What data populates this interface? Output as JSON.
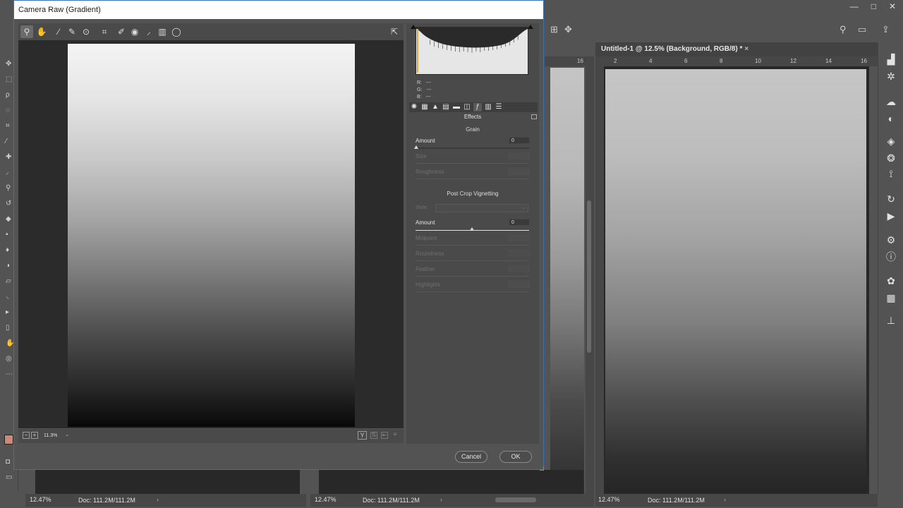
{
  "dialog": {
    "title": "Camera Raw (Gradient)",
    "ok_label": "OK",
    "cancel_label": "Cancel"
  },
  "toolbar_tools": [
    "zoom-tool",
    "hand-tool",
    "white-balance-tool",
    "color-sampler-tool",
    "targeted-adjustment-tool",
    "crop-tool",
    "straighten-tool",
    "red-eye-tool",
    "adjustment-brush-tool",
    "graduated-filter-tool",
    "radial-filter-tool"
  ],
  "preview": {
    "zoom_level": "11.3%",
    "zoom_chevron": "⌄",
    "before_after": "Y"
  },
  "readout": {
    "r_label": "R:",
    "r_value": "---",
    "g_label": "G:",
    "g_value": "---",
    "b_label": "B:",
    "b_value": "---"
  },
  "panel": {
    "name": "Effects",
    "grain": {
      "title": "Grain",
      "amount_label": "Amount",
      "amount_value": "0",
      "size_label": "Size",
      "roughness_label": "Roughness"
    },
    "vignette": {
      "title": "Post Crop Vignetting",
      "style_label": "Style:",
      "amount_label": "Amount",
      "amount_value": "0",
      "midpoint_label": "Midpoint",
      "roundness_label": "Roundness",
      "feather_label": "Feather",
      "highlights_label": "Highlights"
    }
  },
  "photoshop": {
    "doc_title": "Untitled-1 @ 12.5% (Background, RGB/8) *",
    "doc_close": "×",
    "status": [
      {
        "zoom": "12.47%",
        "doc": "Doc: 111.2M/111.2M"
      },
      {
        "zoom": "12.47%",
        "doc": "Doc: 111.2M/111.2M"
      },
      {
        "zoom": "12.47%",
        "doc": "Doc: 111.2M/111.2M"
      }
    ],
    "ruler_marks": [
      "2",
      "4",
      "6",
      "8",
      "10",
      "12",
      "14",
      "16"
    ],
    "ruler_16": "16",
    "window_buttons": [
      "—",
      "□",
      "✕"
    ]
  },
  "colors": {
    "dialog_bg": "#535353",
    "preview_top": "#f4f4f4",
    "preview_bottom": "#080808",
    "accent_border": "#3a72b8"
  }
}
